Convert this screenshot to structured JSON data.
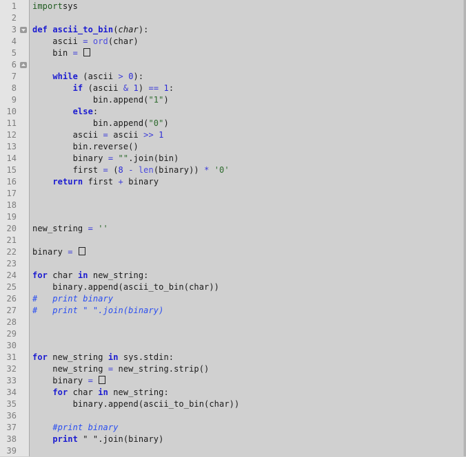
{
  "editor": {
    "language": "python",
    "fold_markers": [
      {
        "line": 3,
        "icon": "fold-collapse-icon",
        "direction": "down"
      },
      {
        "line": 6,
        "icon": "fold-expand-icon",
        "direction": "up"
      }
    ],
    "lines": [
      {
        "n": "1",
        "tokens": [
          [
            "imp",
            "import"
          ],
          [
            "",
            "sys"
          ]
        ]
      },
      {
        "n": "2",
        "tokens": []
      },
      {
        "n": "3",
        "tokens": [
          [
            "kw",
            "def"
          ],
          [
            "",
            " "
          ],
          [
            "kw",
            "ascii_to_bin"
          ],
          [
            "",
            "("
          ],
          [
            "it",
            "char"
          ],
          [
            "",
            "):"
          ]
        ]
      },
      {
        "n": "4",
        "tokens": [
          [
            "",
            "    ascii "
          ],
          [
            "op",
            "="
          ],
          [
            "",
            " "
          ],
          [
            "bi",
            "ord"
          ],
          [
            "",
            "(char)"
          ]
        ]
      },
      {
        "n": "5",
        "tokens": [
          [
            "",
            "    bin "
          ],
          [
            "op",
            "="
          ],
          [
            "",
            " "
          ],
          [
            "box",
            "[]"
          ]
        ]
      },
      {
        "n": "6",
        "tokens": []
      },
      {
        "n": "7",
        "tokens": [
          [
            "",
            "    "
          ],
          [
            "kw",
            "while"
          ],
          [
            "",
            " (ascii "
          ],
          [
            "op",
            ">"
          ],
          [
            "",
            " "
          ],
          [
            "num",
            "0"
          ],
          [
            "",
            "):"
          ]
        ]
      },
      {
        "n": "8",
        "tokens": [
          [
            "",
            "        "
          ],
          [
            "kw",
            "if"
          ],
          [
            "",
            " (ascii "
          ],
          [
            "op",
            "&"
          ],
          [
            "",
            " "
          ],
          [
            "num",
            "1"
          ],
          [
            "",
            ") "
          ],
          [
            "op",
            "=="
          ],
          [
            "",
            " "
          ],
          [
            "num",
            "1"
          ],
          [
            "",
            ":"
          ]
        ]
      },
      {
        "n": "9",
        "tokens": [
          [
            "",
            "            bin.append("
          ],
          [
            "str",
            "\"1\""
          ],
          [
            "",
            ")"
          ]
        ]
      },
      {
        "n": "10",
        "tokens": [
          [
            "",
            "        "
          ],
          [
            "kw",
            "else"
          ],
          [
            "",
            ":"
          ]
        ]
      },
      {
        "n": "11",
        "tokens": [
          [
            "",
            "            bin.append("
          ],
          [
            "str",
            "\"0\""
          ],
          [
            "",
            ")"
          ]
        ]
      },
      {
        "n": "12",
        "tokens": [
          [
            "",
            "        ascii "
          ],
          [
            "op",
            "="
          ],
          [
            "",
            " ascii "
          ],
          [
            "op",
            ">>"
          ],
          [
            "",
            " "
          ],
          [
            "num",
            "1"
          ]
        ]
      },
      {
        "n": "13",
        "tokens": [
          [
            "",
            "        bin.reverse()"
          ]
        ]
      },
      {
        "n": "14",
        "tokens": [
          [
            "",
            "        binary "
          ],
          [
            "op",
            "="
          ],
          [
            "",
            " "
          ],
          [
            "str",
            "\"\""
          ],
          [
            "",
            ".join(bin)"
          ]
        ]
      },
      {
        "n": "15",
        "tokens": [
          [
            "",
            "        first "
          ],
          [
            "op",
            "="
          ],
          [
            "",
            " ("
          ],
          [
            "num",
            "8"
          ],
          [
            "",
            " "
          ],
          [
            "op",
            "-"
          ],
          [
            "",
            " "
          ],
          [
            "bi",
            "len"
          ],
          [
            "",
            "(binary)) "
          ],
          [
            "op",
            "*"
          ],
          [
            "",
            " "
          ],
          [
            "str",
            "'0'"
          ]
        ]
      },
      {
        "n": "16",
        "tokens": [
          [
            "",
            "    "
          ],
          [
            "kw",
            "return"
          ],
          [
            "",
            " first "
          ],
          [
            "op",
            "+"
          ],
          [
            "",
            " binary"
          ]
        ]
      },
      {
        "n": "17",
        "tokens": []
      },
      {
        "n": "18",
        "tokens": []
      },
      {
        "n": "19",
        "tokens": []
      },
      {
        "n": "20",
        "tokens": [
          [
            "",
            "new_string "
          ],
          [
            "op",
            "="
          ],
          [
            "",
            " "
          ],
          [
            "str",
            "''"
          ]
        ]
      },
      {
        "n": "21",
        "tokens": []
      },
      {
        "n": "22",
        "tokens": [
          [
            "",
            "binary "
          ],
          [
            "op",
            "="
          ],
          [
            "",
            " "
          ],
          [
            "box",
            "[]"
          ]
        ]
      },
      {
        "n": "23",
        "tokens": []
      },
      {
        "n": "24",
        "tokens": [
          [
            "kw",
            "for"
          ],
          [
            "",
            " char "
          ],
          [
            "kw",
            "in"
          ],
          [
            "",
            " new_string:"
          ]
        ]
      },
      {
        "n": "25",
        "tokens": [
          [
            "",
            "    binary.append(ascii_to_bin(char))"
          ]
        ]
      },
      {
        "n": "26",
        "tokens": [
          [
            "cm",
            "#   print binary"
          ]
        ]
      },
      {
        "n": "27",
        "tokens": [
          [
            "cm",
            "#   print \" \".join(binary)"
          ]
        ]
      },
      {
        "n": "28",
        "tokens": []
      },
      {
        "n": "29",
        "tokens": []
      },
      {
        "n": "30",
        "tokens": []
      },
      {
        "n": "31",
        "tokens": [
          [
            "kw",
            "for"
          ],
          [
            "",
            " new_string "
          ],
          [
            "kw",
            "in"
          ],
          [
            "",
            " sys.stdin:"
          ]
        ]
      },
      {
        "n": "32",
        "tokens": [
          [
            "",
            "    new_string "
          ],
          [
            "op",
            "="
          ],
          [
            "",
            " new_string.strip()"
          ]
        ]
      },
      {
        "n": "33",
        "tokens": [
          [
            "",
            "    binary "
          ],
          [
            "op",
            "="
          ],
          [
            "",
            " "
          ],
          [
            "box",
            "[]"
          ]
        ]
      },
      {
        "n": "34",
        "tokens": [
          [
            "",
            "    "
          ],
          [
            "kw",
            "for"
          ],
          [
            "",
            " char "
          ],
          [
            "kw",
            "in"
          ],
          [
            "",
            " new_string:"
          ]
        ]
      },
      {
        "n": "35",
        "tokens": [
          [
            "",
            "        binary.append(ascii_to_bin(char))"
          ]
        ]
      },
      {
        "n": "36",
        "tokens": []
      },
      {
        "n": "37",
        "tokens": [
          [
            "",
            "    "
          ],
          [
            "cm",
            "#print binary"
          ]
        ]
      },
      {
        "n": "38",
        "tokens": [
          [
            "",
            "    "
          ],
          [
            "kw",
            "print"
          ],
          [
            "",
            " \" \".join(binary)"
          ]
        ]
      },
      {
        "n": "39",
        "tokens": []
      }
    ]
  }
}
